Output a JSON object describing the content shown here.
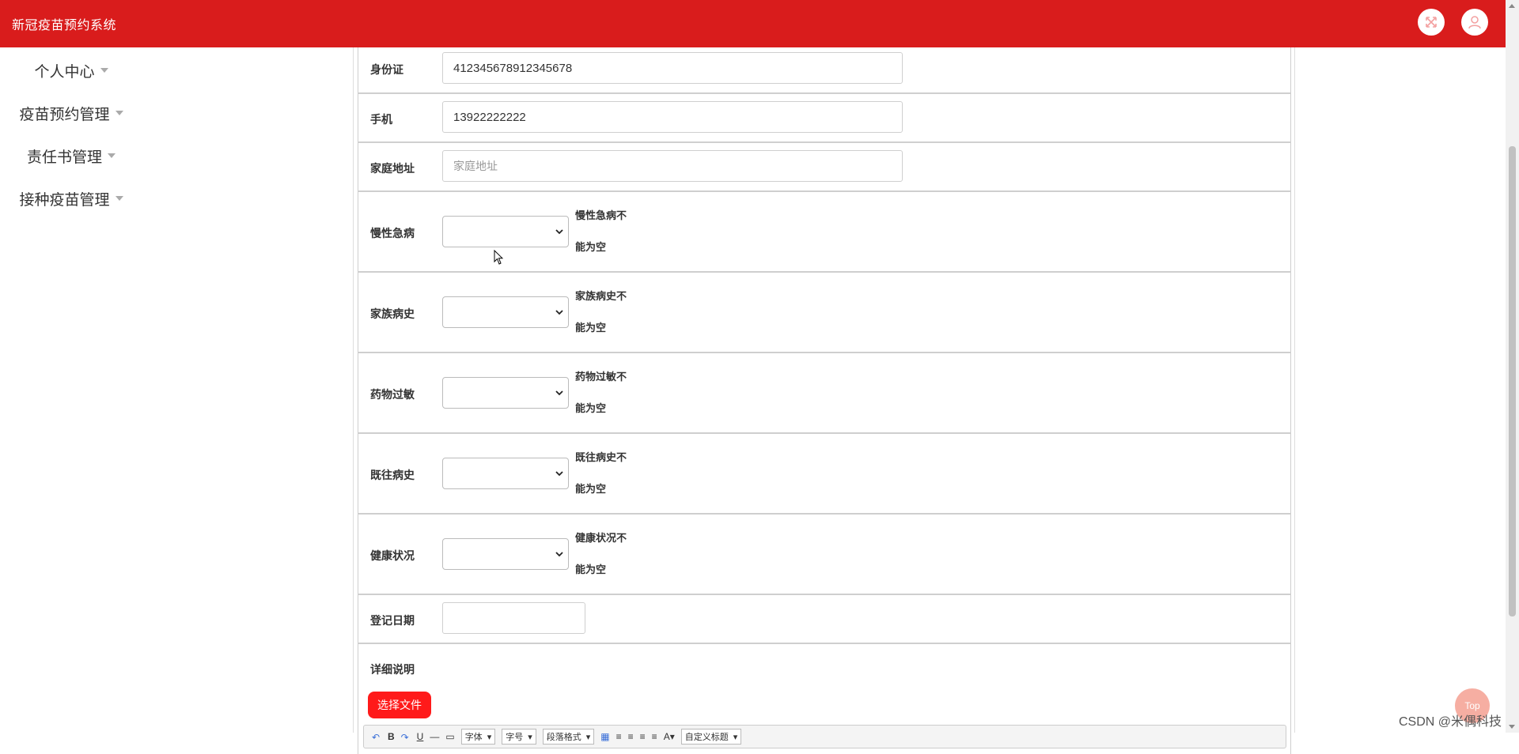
{
  "header": {
    "title": "新冠疫苗预约系统",
    "fullscreen_icon": "expand-icon",
    "user_icon": "user-icon"
  },
  "sidebar": {
    "items": [
      {
        "label": "个人中心"
      },
      {
        "label": "疫苗预约管理"
      },
      {
        "label": "责任书管理"
      },
      {
        "label": "接种疫苗管理"
      }
    ]
  },
  "form": {
    "id_card": {
      "label": "身份证",
      "value": "412345678912345678"
    },
    "phone": {
      "label": "手机",
      "value": "13922222222"
    },
    "address": {
      "label": "家庭地址",
      "placeholder": "家庭地址"
    },
    "chronic": {
      "label": "慢性急病",
      "hint1": "慢性急病不",
      "hint2": "能为空"
    },
    "family_history": {
      "label": "家族病史",
      "hint1": "家族病史不",
      "hint2": "能为空"
    },
    "drug_allergy": {
      "label": "药物过敏",
      "hint1": "药物过敏不",
      "hint2": "能为空"
    },
    "past_history": {
      "label": "既往病史",
      "hint1": "既往病史不",
      "hint2": "能为空"
    },
    "health": {
      "label": "健康状况",
      "hint1": "健康状况不",
      "hint2": "能为空"
    },
    "reg_date": {
      "label": "登记日期",
      "value": ""
    },
    "detail": {
      "label": "详细说明",
      "file_button": "选择文件"
    }
  },
  "editor_toolbar": {
    "font_family": "字体",
    "font_size": "字号",
    "paragraph": "段落格式",
    "custom_title": "自定义标题"
  },
  "floating": {
    "top_label": "Top"
  },
  "watermark": "CSDN @米偶科技",
  "colors": {
    "header_bg": "#d91c1c",
    "accent_button": "#ff1a1a"
  }
}
